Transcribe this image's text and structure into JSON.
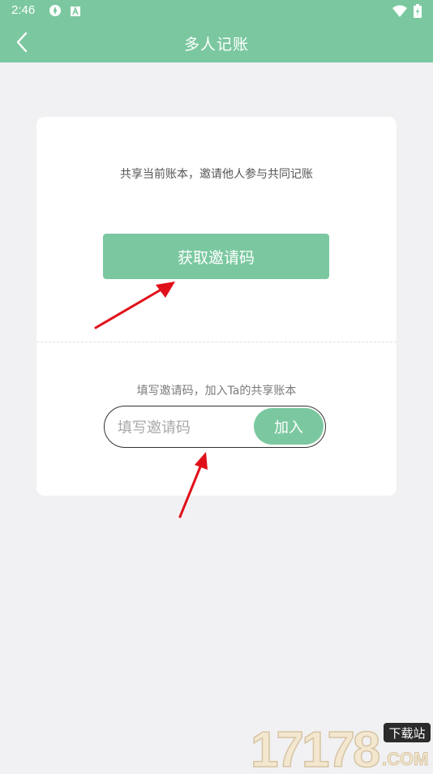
{
  "status_bar": {
    "time": "2:46",
    "left_icons": [
      "vpn-icon",
      "font-icon"
    ],
    "right_icons": [
      "wifi-icon",
      "battery-icon"
    ]
  },
  "header": {
    "title": "多人记账",
    "back_icon": "chevron-left-icon"
  },
  "card": {
    "share_text": "共享当前账本，邀请他人参与共同记账",
    "get_code_label": "获取邀请码",
    "join_text": "填写邀请码，加入Ta的共享账本",
    "code_input_placeholder": "填写邀请码",
    "code_input_value": "",
    "join_label": "加入"
  },
  "watermark": {
    "digits": "17178",
    "badge": "下载站",
    "suffix": ".COM"
  },
  "colors": {
    "accent": "#7bc8a0",
    "background": "#f1f1f3",
    "arrow": "#e0101a"
  }
}
